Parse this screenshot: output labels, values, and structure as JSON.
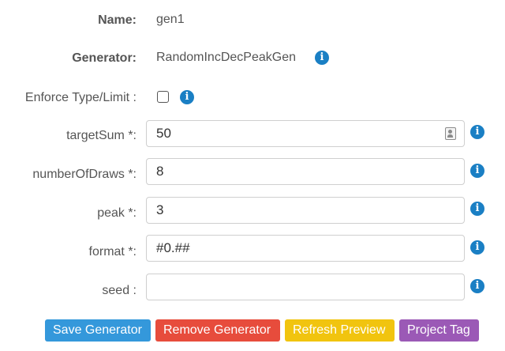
{
  "form": {
    "name": {
      "label": "Name:",
      "value": "gen1"
    },
    "generator": {
      "label": "Generator:",
      "value": "RandomIncDecPeakGen"
    },
    "enforce": {
      "label": "Enforce Type/Limit :",
      "checked": false
    },
    "fields": [
      {
        "label": "targetSum *:",
        "value": "50",
        "placeholder": ""
      },
      {
        "label": "numberOfDraws *:",
        "value": "8",
        "placeholder": ""
      },
      {
        "label": "peak *:",
        "value": "3",
        "placeholder": ""
      },
      {
        "label": "format *:",
        "value": "#0.##",
        "placeholder": ""
      },
      {
        "label": "seed :",
        "value": "",
        "placeholder": ""
      }
    ]
  },
  "icons": {
    "info": "info-icon",
    "contact_card": "contact-card-icon"
  },
  "info_glyph": "i",
  "buttons": {
    "save": "Save Generator",
    "remove": "Remove Generator",
    "refresh": "Refresh Preview",
    "project_tag": "Project Tag"
  },
  "colors": {
    "info_blue": "#1a7fc4",
    "save": "#3498db",
    "remove": "#e74c3c",
    "refresh": "#f1c40f",
    "project_tag": "#9b59b6"
  }
}
